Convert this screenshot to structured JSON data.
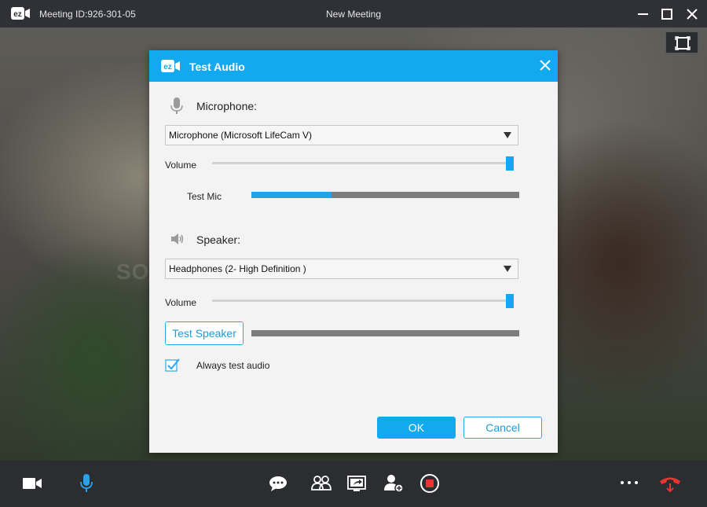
{
  "titlebar": {
    "logo_text": "ez",
    "meeting_id": "Meeting ID:926-301-05",
    "window_title": "New Meeting"
  },
  "dialog": {
    "title": "Test Audio",
    "logo_text": "ez",
    "microphone": {
      "label": "Microphone:",
      "device": "Microphone (Microsoft LifeCam V)",
      "volume_label": "Volume",
      "volume_level": 1.0,
      "test_mic_label": "Test Mic",
      "test_mic_level": 0.3
    },
    "speaker": {
      "label": "Speaker:",
      "device": "Headphones (2- High Definition )",
      "volume_label": "Volume",
      "volume_level": 1.0,
      "test_speaker_label": "Test Speaker",
      "test_speaker_level": 0.0
    },
    "always_test": {
      "label": "Always test audio",
      "checked": true
    },
    "ok_label": "OK",
    "cancel_label": "Cancel"
  },
  "watermark": "SOFTPEDIA",
  "colors": {
    "accent": "#13a9ef",
    "titlebar": "#2f3136",
    "toolbar": "#2b2d31",
    "hangup": "#e8352f",
    "record": "#e8352f"
  },
  "toolbar_icons": [
    "video-camera-icon",
    "microphone-icon",
    "chat-icon",
    "participants-icon",
    "share-screen-icon",
    "add-user-icon",
    "record-icon",
    "more-icon",
    "hang-up-icon"
  ]
}
